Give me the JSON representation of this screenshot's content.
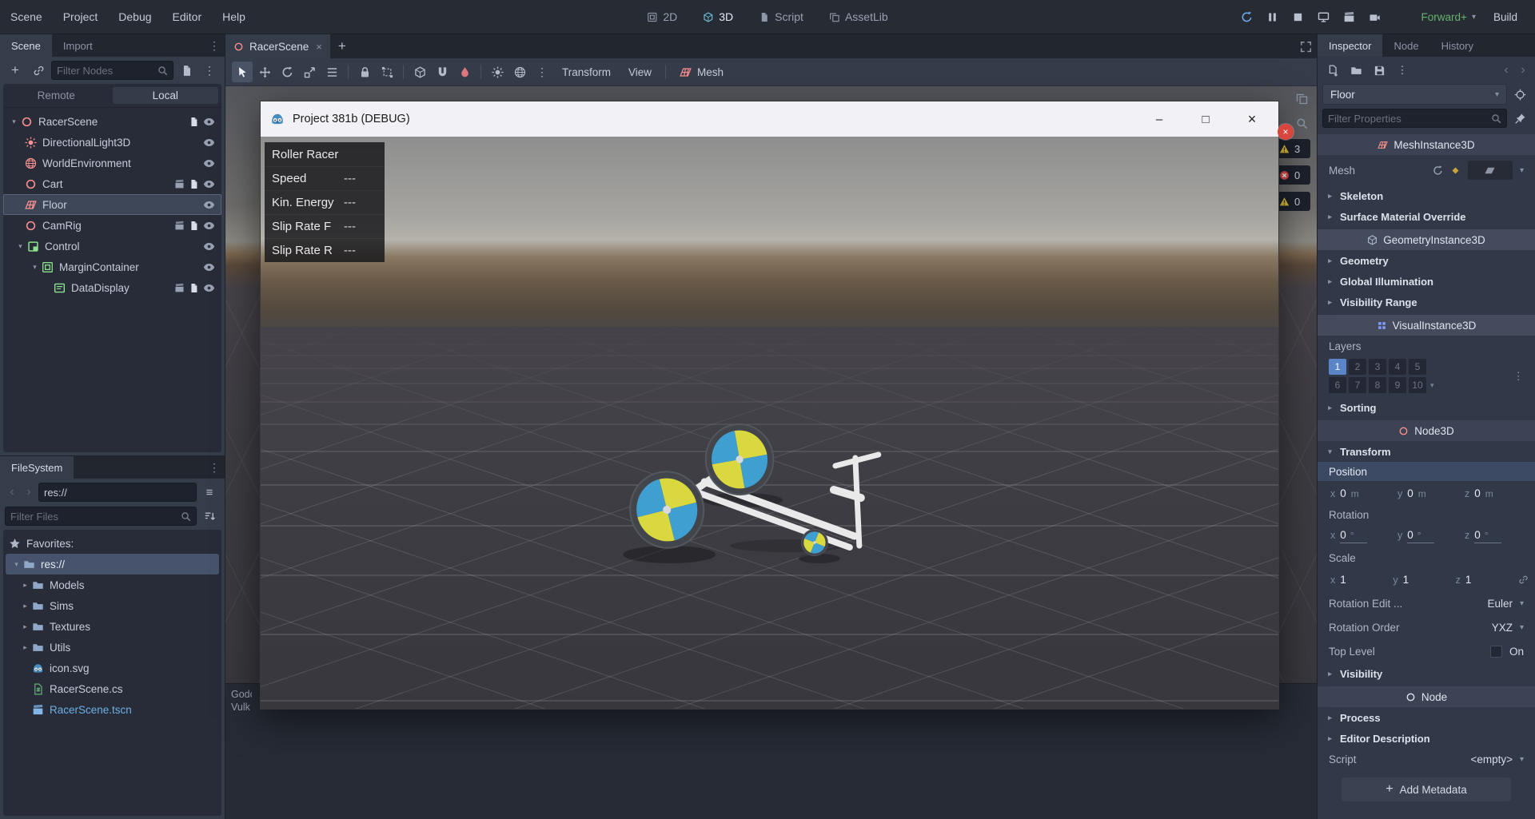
{
  "icons": {
    "dots": "⋮",
    "chevron_left": "‹",
    "chevron_right": "›",
    "plus": "+",
    "caret_down": "▾",
    "arrow_right": "▸",
    "arrow_down": "▾",
    "star": "★",
    "hamburger": "≡",
    "minimize": "–",
    "maximize": "□",
    "close": "×"
  },
  "menubar": {
    "menus": [
      "Scene",
      "Project",
      "Debug",
      "Editor",
      "Help"
    ],
    "workspaces": [
      "2D",
      "3D",
      "Script",
      "AssetLib"
    ],
    "active_workspace": "3D",
    "renderer": "Forward+",
    "build": "Build"
  },
  "scene_dock": {
    "tabs": [
      "Scene",
      "Import"
    ],
    "filter_placeholder": "Filter Nodes",
    "remote": "Remote",
    "local": "Local",
    "nodes": [
      {
        "label": "RacerScene"
      },
      {
        "label": "DirectionalLight3D"
      },
      {
        "label": "WorldEnvironment"
      },
      {
        "label": "Cart"
      },
      {
        "label": "Floor"
      },
      {
        "label": "CamRig"
      },
      {
        "label": "Control"
      },
      {
        "label": "MarginContainer"
      },
      {
        "label": "DataDisplay"
      }
    ]
  },
  "filesystem": {
    "tab": "FileSystem",
    "path": "res://",
    "filter_placeholder": "Filter Files",
    "favorites": "Favorites:",
    "items": [
      {
        "label": "res://"
      },
      {
        "label": "Models"
      },
      {
        "label": "Sims"
      },
      {
        "label": "Textures"
      },
      {
        "label": "Utils"
      },
      {
        "label": "icon.svg"
      },
      {
        "label": "RacerScene.cs"
      },
      {
        "label": "RacerScene.tscn"
      }
    ]
  },
  "viewport": {
    "scene_tab": "RacerScene",
    "menus": {
      "transform": "Transform",
      "view": "View",
      "mesh": "Mesh"
    },
    "output_lines": [
      "Godo",
      "Vulk"
    ],
    "badges": [
      {
        "count": "3",
        "kind": "warning"
      },
      {
        "count": "0",
        "kind": "error"
      },
      {
        "count": "0",
        "kind": "warning"
      }
    ]
  },
  "game": {
    "title": "Project 381b (DEBUG)",
    "hud_title": "Roller Racer",
    "hud_rows": [
      {
        "label": "Speed",
        "value": "---"
      },
      {
        "label": "Kin. Energy",
        "value": "---"
      },
      {
        "label": "Slip Rate F",
        "value": "---"
      },
      {
        "label": "Slip Rate R",
        "value": "---"
      }
    ],
    "colors": {
      "wheel_blue": "#3f9fd0",
      "wheel_yellow": "#d9d83e"
    }
  },
  "inspector": {
    "tabs": [
      "Inspector",
      "Node",
      "History"
    ],
    "object": "Floor",
    "filter_placeholder": "Filter Properties",
    "class_bar": "MeshInstance3D",
    "mesh_label": "Mesh",
    "skeleton": "Skeleton",
    "surface_material_override": "Surface Material Override",
    "geometry_bar": "GeometryInstance3D",
    "geometry": "Geometry",
    "global_illumination": "Global Illumination",
    "visibility_range": "Visibility Range",
    "visual_bar": "VisualInstance3D",
    "layers_label": "Layers",
    "layers": [
      "1",
      "2",
      "3",
      "4",
      "5",
      "6",
      "7",
      "8",
      "9",
      "10"
    ],
    "active_layer": "1",
    "sorting": "Sorting",
    "node3d_bar": "Node3D",
    "transform": "Transform",
    "position_label": "Position",
    "rotation_label": "Rotation",
    "scale_label": "Scale",
    "axes": [
      "x",
      "y",
      "z"
    ],
    "position": {
      "x": "0",
      "y": "0",
      "z": "0",
      "unit": "m"
    },
    "rotation": {
      "x": "0",
      "y": "0",
      "z": "0",
      "unit": "°"
    },
    "scale": {
      "x": "1",
      "y": "1",
      "z": "1"
    },
    "rotation_edit": {
      "label": "Rotation Edit ...",
      "value": "Euler"
    },
    "rotation_order": {
      "label": "Rotation Order",
      "value": "YXZ"
    },
    "top_level": {
      "label": "Top Level",
      "value": "On"
    },
    "visibility": "Visibility",
    "node_bar": "Node",
    "process": "Process",
    "editor_description": "Editor Description",
    "script_label": "Script",
    "script_value": "<empty>",
    "add_metadata": "Add Metadata"
  }
}
